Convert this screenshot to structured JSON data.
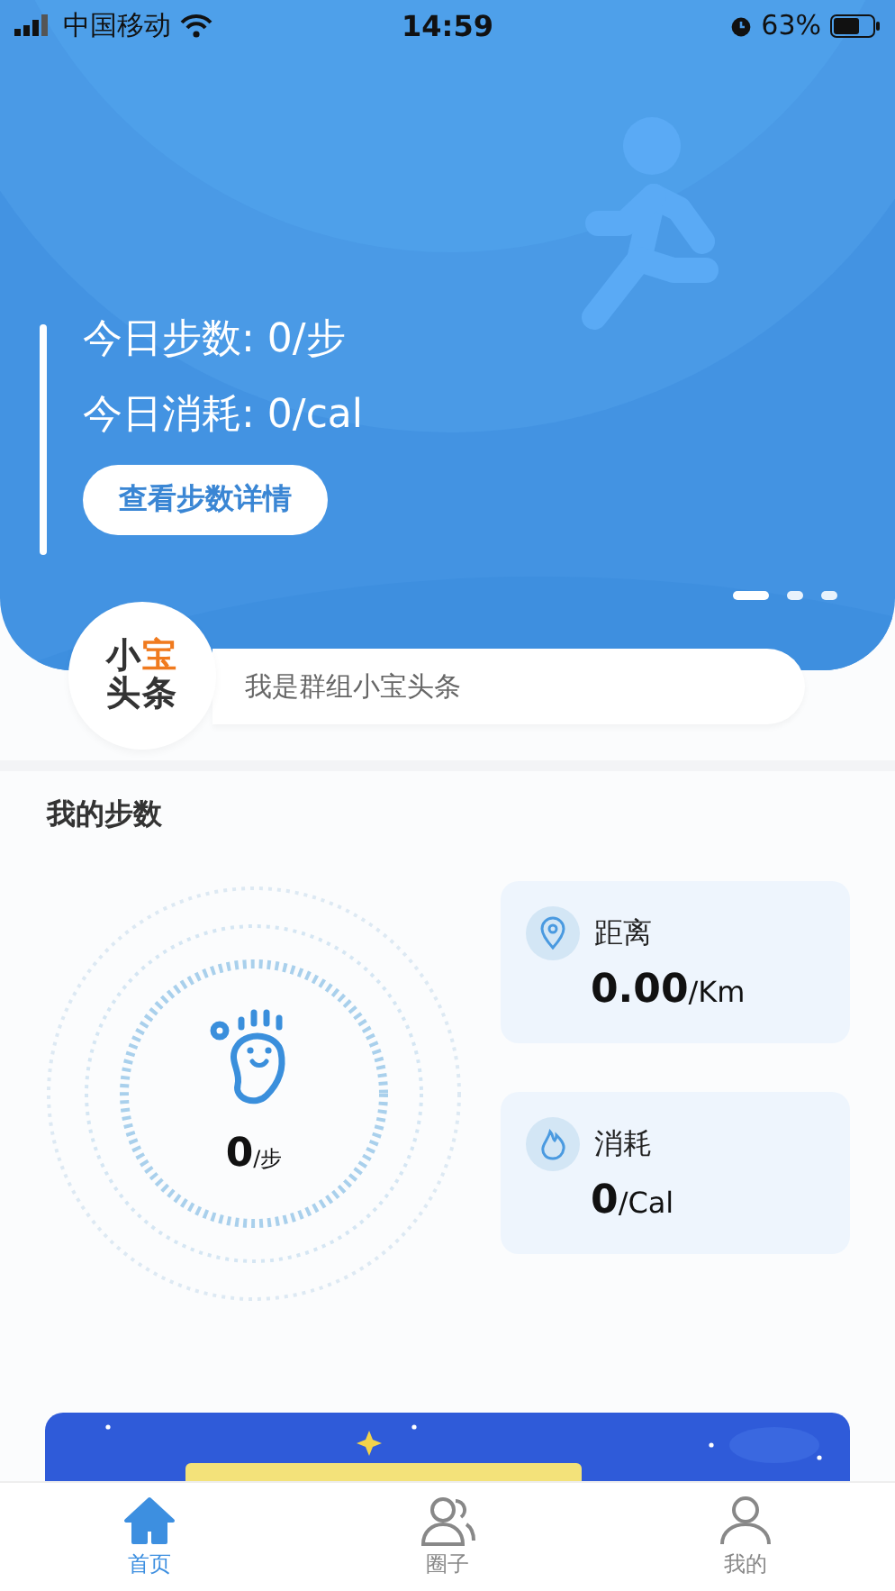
{
  "status_bar": {
    "carrier": "中国移动",
    "time": "14:59",
    "battery": "63%"
  },
  "hero": {
    "steps_line": "今日步数: 0/步",
    "calories_line": "今日消耗: 0/cal",
    "button": "查看步数详情",
    "slides": [
      {
        "selected": true
      },
      {
        "selected": false
      },
      {
        "selected": false
      }
    ]
  },
  "news": {
    "logo": [
      {
        "text": "小",
        "accent": false
      },
      {
        "text": "宝",
        "accent": true
      },
      {
        "text": "头",
        "accent": false
      },
      {
        "text": "条",
        "accent": false
      }
    ],
    "headline": "我是群组小宝头条"
  },
  "my_steps": {
    "title": "我的步数",
    "value": "0",
    "unit": "/步",
    "stats": [
      {
        "kind": "distance",
        "label": "距离",
        "value": "0.00",
        "unit": "/Km"
      },
      {
        "kind": "calories",
        "label": "消耗",
        "value": "0",
        "unit": "/Cal"
      }
    ]
  },
  "tab_bar": [
    {
      "kind": "home",
      "label": "首页",
      "selected": true
    },
    {
      "kind": "group",
      "label": "圈子",
      "selected": false
    },
    {
      "kind": "profile",
      "label": "我的",
      "selected": false
    }
  ]
}
